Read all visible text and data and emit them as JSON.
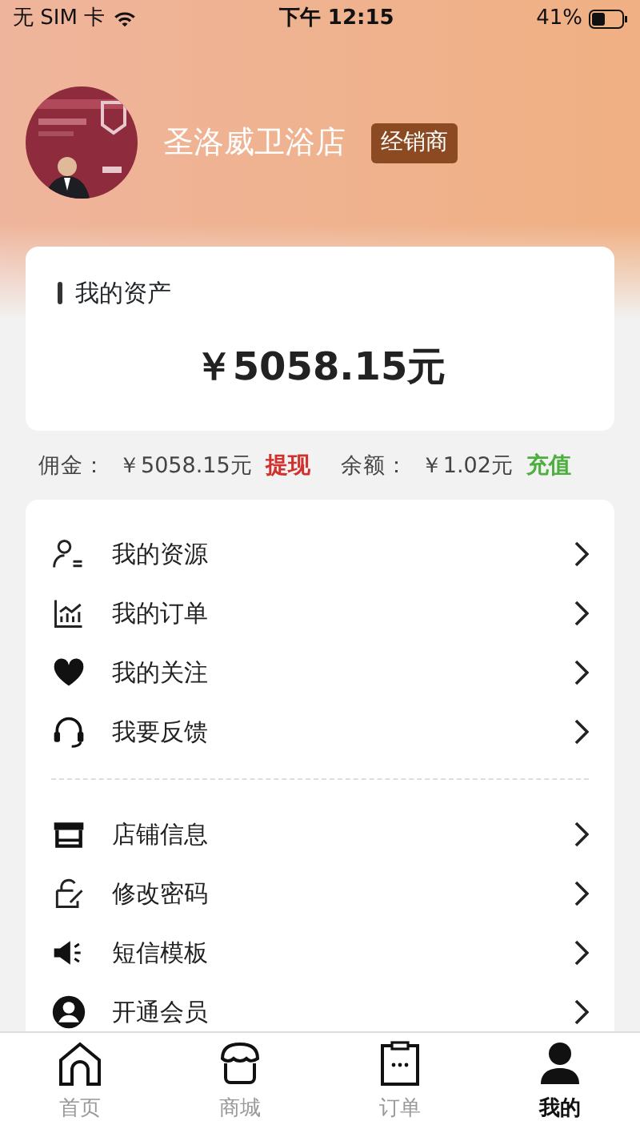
{
  "status_bar": {
    "carrier": "无 SIM 卡",
    "time": "下午 12:15",
    "battery": "41%"
  },
  "profile": {
    "store_name": "圣洛威卫浴店",
    "badge": "经销商"
  },
  "assets": {
    "title": "我的资产",
    "amount": "￥5058.15元"
  },
  "balances": [
    {
      "label": "佣金：",
      "value": "￥5058.15元",
      "action": "提现",
      "color": "#d0312d"
    },
    {
      "label": "余额：",
      "value": "￥1.02元",
      "action": "充值",
      "color": "#4caf3e"
    }
  ],
  "menu_groups": [
    {
      "items": [
        {
          "label": "我的资源"
        },
        {
          "label": "我的订单"
        },
        {
          "label": "我的关注"
        },
        {
          "label": "我要反馈"
        }
      ]
    },
    {
      "items": [
        {
          "label": "店铺信息"
        },
        {
          "label": "修改密码"
        },
        {
          "label": "短信模板"
        },
        {
          "label": "开通会员"
        }
      ]
    }
  ],
  "tab_bar": [
    {
      "label": "首页",
      "selected": false
    },
    {
      "label": "商城",
      "selected": false
    },
    {
      "label": "订单",
      "selected": false
    },
    {
      "label": "我的",
      "selected": true
    }
  ]
}
